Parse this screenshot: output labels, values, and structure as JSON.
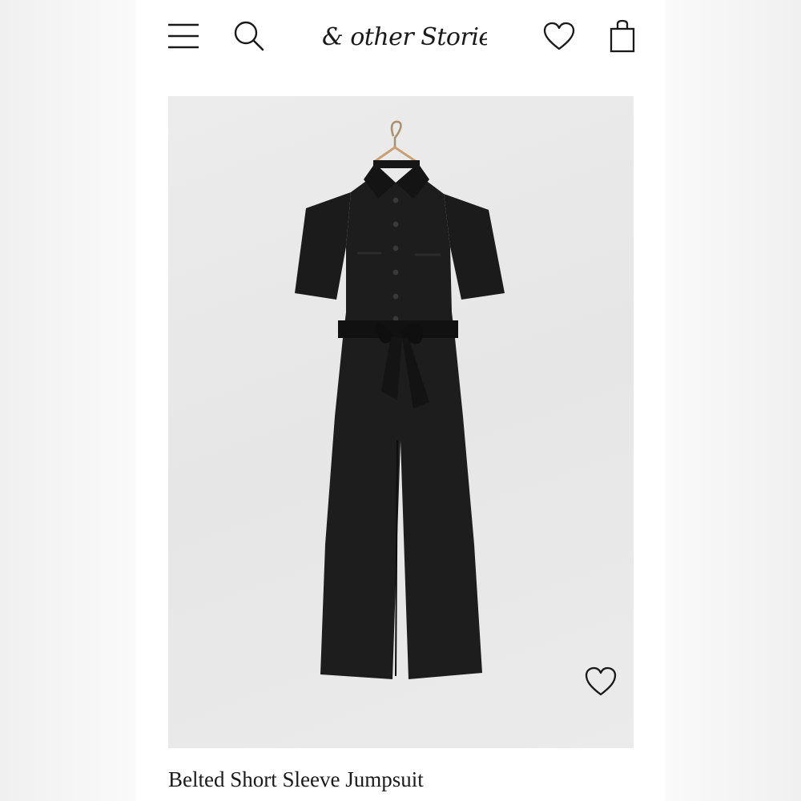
{
  "header": {
    "logo_text": "& other Stories",
    "icons": {
      "menu": "menu-icon",
      "search": "search-icon",
      "wishlist": "heart-icon",
      "bag": "shopping-bag-icon"
    }
  },
  "product": {
    "title": "Belted Short Sleeve Jumpsuit",
    "image_icon": "heart-icon",
    "garment_color": "#1d1d1d"
  },
  "colors": {
    "page_bg": "#ffffff",
    "image_bg": "#e9e9e9",
    "text": "#1a1a1a"
  }
}
